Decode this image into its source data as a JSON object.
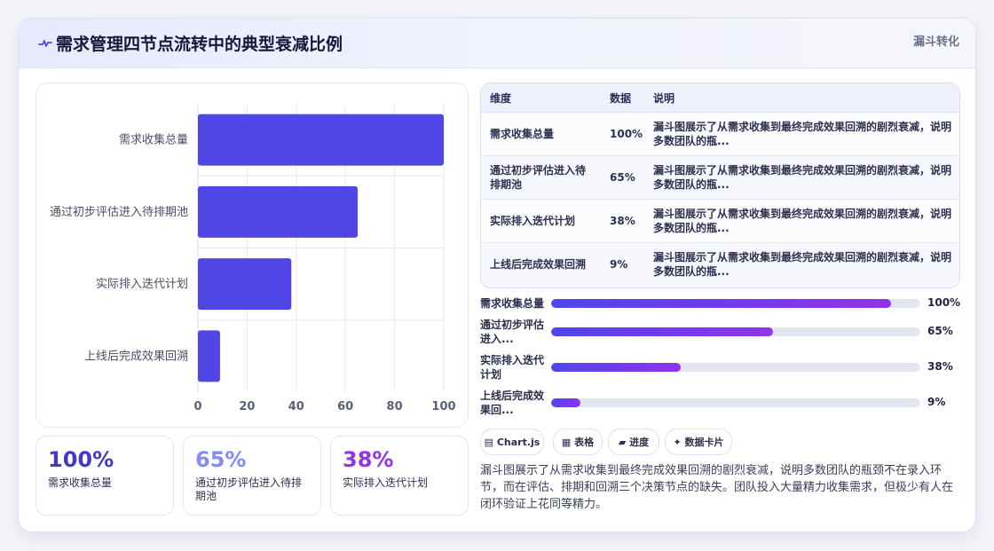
{
  "header": {
    "title": "需求管理四节点流转中的典型衰减比例",
    "tag": "漏斗转化"
  },
  "colors": {
    "bar": "#4f46e5",
    "gradient_start": "#4f46e5",
    "gradient_end": "#9333ea",
    "kpi_1": "#4338ca",
    "kpi_2": "#818cf8",
    "kpi_3": "#9333ea"
  },
  "chart_data": {
    "type": "bar",
    "orientation": "horizontal",
    "categories": [
      "需求收集总量",
      "通过初步评估进入待排期池",
      "实际排入迭代计划",
      "上线后完成效果回溯"
    ],
    "values": [
      100,
      65,
      38,
      9
    ],
    "xlim": [
      0,
      100
    ],
    "xticks": [
      "0",
      "20",
      "40",
      "60",
      "80",
      "100"
    ],
    "grid": true
  },
  "kpis": [
    {
      "value": "100%",
      "label": "需求收集总量"
    },
    {
      "value": "65%",
      "label": "通过初步评估进入待排期池"
    },
    {
      "value": "38%",
      "label": "实际排入迭代计划"
    }
  ],
  "table": {
    "headers": [
      "维度",
      "数据",
      "说明"
    ],
    "rows": [
      {
        "dim": "需求收集总量",
        "val": "100%",
        "desc": "漏斗图展示了从需求收集到最终完成效果回溯的剧烈衰减，说明多数团队的瓶..."
      },
      {
        "dim": "通过初步评估进入待排期池",
        "val": "65%",
        "desc": "漏斗图展示了从需求收集到最终完成效果回溯的剧烈衰减，说明多数团队的瓶..."
      },
      {
        "dim": "实际排入迭代计划",
        "val": "38%",
        "desc": "漏斗图展示了从需求收集到最终完成效果回溯的剧烈衰减，说明多数团队的瓶..."
      },
      {
        "dim": "上线后完成效果回溯",
        "val": "9%",
        "desc": "漏斗图展示了从需求收集到最终完成效果回溯的剧烈衰减，说明多数团队的瓶..."
      }
    ]
  },
  "progress": [
    {
      "label": "需求收集总量",
      "value": "100%",
      "fraction": 0.92
    },
    {
      "label": "通过初步评估进入...",
      "value": "65%",
      "fraction": 0.6
    },
    {
      "label": "实际排入迭代计划",
      "value": "38%",
      "fraction": 0.35
    },
    {
      "label": "上线后完成效果回...",
      "value": "9%",
      "fraction": 0.08
    }
  ],
  "chips": [
    {
      "icon": "chart-icon",
      "label": "▤ Chart.js"
    },
    {
      "icon": "table-icon",
      "label": "▦ 表格"
    },
    {
      "icon": "progress-icon",
      "label": "▰ 进度"
    },
    {
      "icon": "sparkle-icon",
      "label": "✦ 数据卡片"
    }
  ],
  "summary": "漏斗图展示了从需求收集到最终完成效果回溯的剧烈衰减，说明多数团队的瓶颈不在录入环节，而在评估、排期和回溯三个决策节点的缺失。团队投入大量精力收集需求，但极少有人在闭环验证上花同等精力。"
}
